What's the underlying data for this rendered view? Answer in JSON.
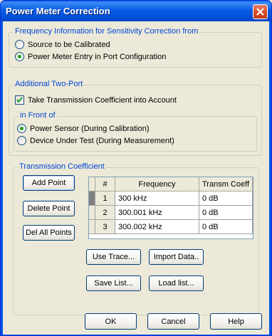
{
  "window": {
    "title": "Power Meter Correction"
  },
  "freq_group": {
    "legend": "Frequency Information for Sensitivity Correction from",
    "options": [
      {
        "label": "Source to be Calibrated",
        "checked": false
      },
      {
        "label": "Power Meter Entry in Port Configuration",
        "checked": true
      }
    ]
  },
  "two_port": {
    "legend": "Additional Two-Port",
    "checkbox_label": "Take Transmission Coefficient into Account",
    "checkbox_checked": true,
    "front": {
      "legend": "in Front of",
      "options": [
        {
          "label": "Power Sensor (During Calibration)",
          "checked": true
        },
        {
          "label": "Device Under Test (During Measurement)",
          "checked": false
        }
      ]
    }
  },
  "trans": {
    "legend": "Transmission Coefficient",
    "buttons": {
      "add": "Add Point",
      "delete": "Delete Point",
      "del_all": "Del All Points",
      "use_trace": "Use Trace...",
      "import": "Import Data..",
      "save": "Save List...",
      "load": "Load list..."
    },
    "table": {
      "columns": [
        "#",
        "Frequency",
        "Transm Coeff"
      ],
      "rows": [
        {
          "num": "1",
          "freq": "300 kHz",
          "coeff": "0 dB"
        },
        {
          "num": "2",
          "freq": "300.001 kHz",
          "coeff": "0 dB"
        },
        {
          "num": "3",
          "freq": "300.002 kHz",
          "coeff": "0 dB"
        }
      ]
    }
  },
  "footer": {
    "ok": "OK",
    "cancel": "Cancel",
    "help": "Help"
  }
}
